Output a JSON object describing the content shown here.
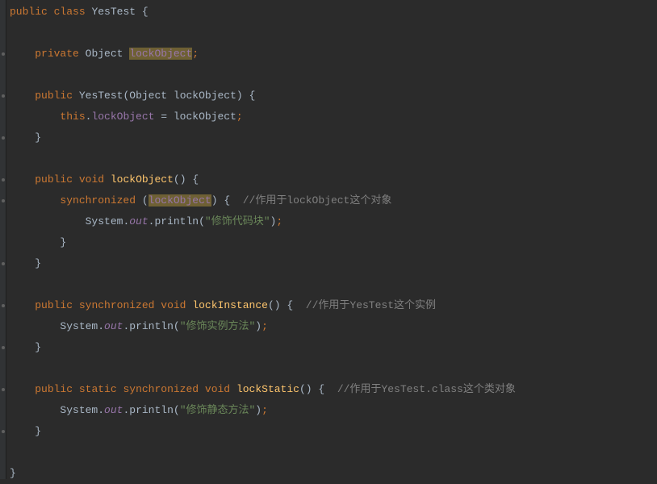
{
  "code": {
    "kw": {
      "public": "public",
      "class": "class",
      "private": "private",
      "void": "void",
      "this": "this",
      "synchronized": "synchronized",
      "static": "static"
    },
    "types": {
      "YesTest": "YesTest",
      "Object": "Object"
    },
    "fields": {
      "lockObject": "lockObject",
      "out": "out"
    },
    "methods": {
      "lockObject": "lockObject",
      "lockInstance": "lockInstance",
      "lockStatic": "lockStatic",
      "println": "println"
    },
    "system": "System",
    "strings": {
      "s1": "\"修饰代码块\"",
      "s2": "\"修饰实例方法\"",
      "s3": "\"修饰静态方法\""
    },
    "comments": {
      "c1": "//作用于lockObject这个对象",
      "c2": "//作用于YesTest这个实例",
      "c3": "//作用于YesTest.class这个类对象"
    },
    "sym": {
      "lbrace": "{",
      "rbrace": "}",
      "lparen": "(",
      "rparen": ")",
      "semi": ";",
      "dot": ".",
      "eq": " = "
    }
  }
}
